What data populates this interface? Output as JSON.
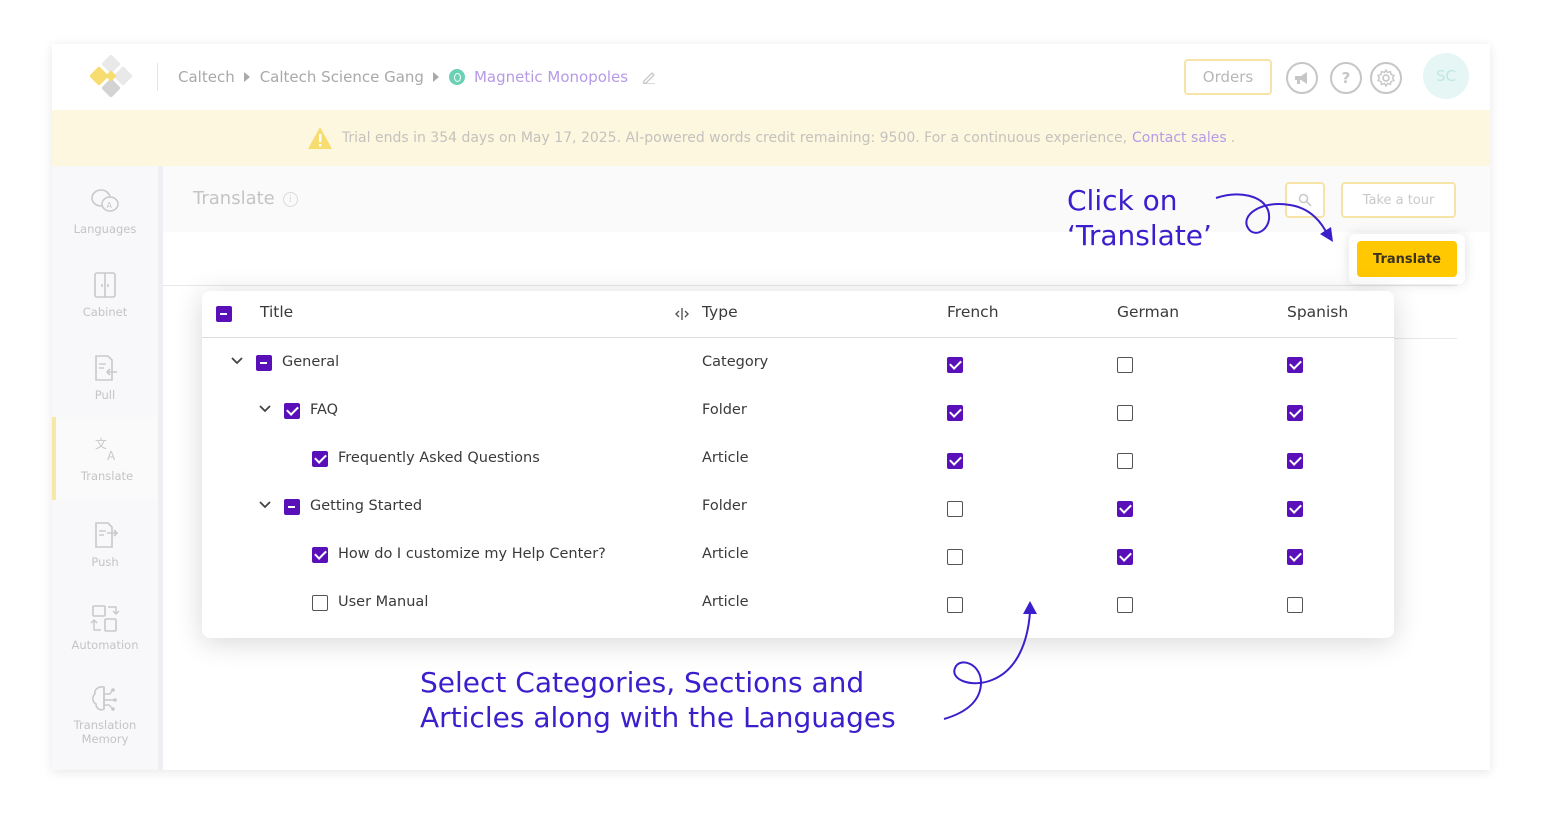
{
  "header": {
    "breadcrumb": [
      "Caltech",
      "Caltech Science Gang",
      "Magnetic Monopoles"
    ],
    "orders_label": "Orders",
    "help_symbol": "?",
    "avatar_initials": "SC"
  },
  "banner": {
    "text": "Trial ends in 354 days on May 17, 2025. AI-powered words credit remaining: 9500. For a continuous experience,",
    "link": "Contact sales",
    "suffix": "."
  },
  "sidebar": {
    "items": [
      {
        "label": "Languages",
        "icon": "languages-icon"
      },
      {
        "label": "Cabinet",
        "icon": "cabinet-icon"
      },
      {
        "label": "Pull",
        "icon": "pull-icon"
      },
      {
        "label": "Translate",
        "icon": "translate-icon",
        "active": true
      },
      {
        "label": "Push",
        "icon": "push-icon"
      },
      {
        "label": "Automation",
        "icon": "automation-icon"
      },
      {
        "label": "Translation Memory",
        "icon": "brain-icon"
      }
    ]
  },
  "page": {
    "title": "Translate",
    "info_symbol": "i",
    "tour_label": "Take a tour",
    "translate_label": "Translate"
  },
  "table": {
    "columns": [
      "Title",
      "Type",
      "French",
      "German",
      "Spanish"
    ],
    "header_checkbox": "indeterminate",
    "rows": [
      {
        "title": "General",
        "type": "Category",
        "level": 0,
        "expandable": true,
        "check": "indeterminate",
        "french": true,
        "german": false,
        "spanish": true
      },
      {
        "title": "FAQ",
        "type": "Folder",
        "level": 1,
        "expandable": true,
        "check": "checked",
        "french": true,
        "german": false,
        "spanish": true
      },
      {
        "title": "Frequently Asked Questions",
        "type": "Article",
        "level": 2,
        "expandable": false,
        "check": "checked",
        "french": true,
        "german": false,
        "spanish": true
      },
      {
        "title": "Getting Started",
        "type": "Folder",
        "level": 1,
        "expandable": true,
        "check": "indeterminate",
        "french": false,
        "german": true,
        "spanish": true
      },
      {
        "title": "How do I customize my Help Center?",
        "type": "Article",
        "level": 2,
        "expandable": false,
        "check": "checked",
        "french": false,
        "german": true,
        "spanish": true
      },
      {
        "title": "User Manual",
        "type": "Article",
        "level": 2,
        "expandable": false,
        "check": "unchecked",
        "french": false,
        "german": false,
        "spanish": false
      }
    ]
  },
  "annotations": {
    "click_line1": "Click on",
    "click_line2": "‘Translate’",
    "select_line1": "Select Categories, Sections and",
    "select_line2": "Articles along with the Languages"
  },
  "colors": {
    "accent": "#5a10b8",
    "annotation": "#3b1fcc",
    "button": "#ffc800",
    "banner_bg": "#fdf7e0",
    "link": "#b79ae6"
  }
}
